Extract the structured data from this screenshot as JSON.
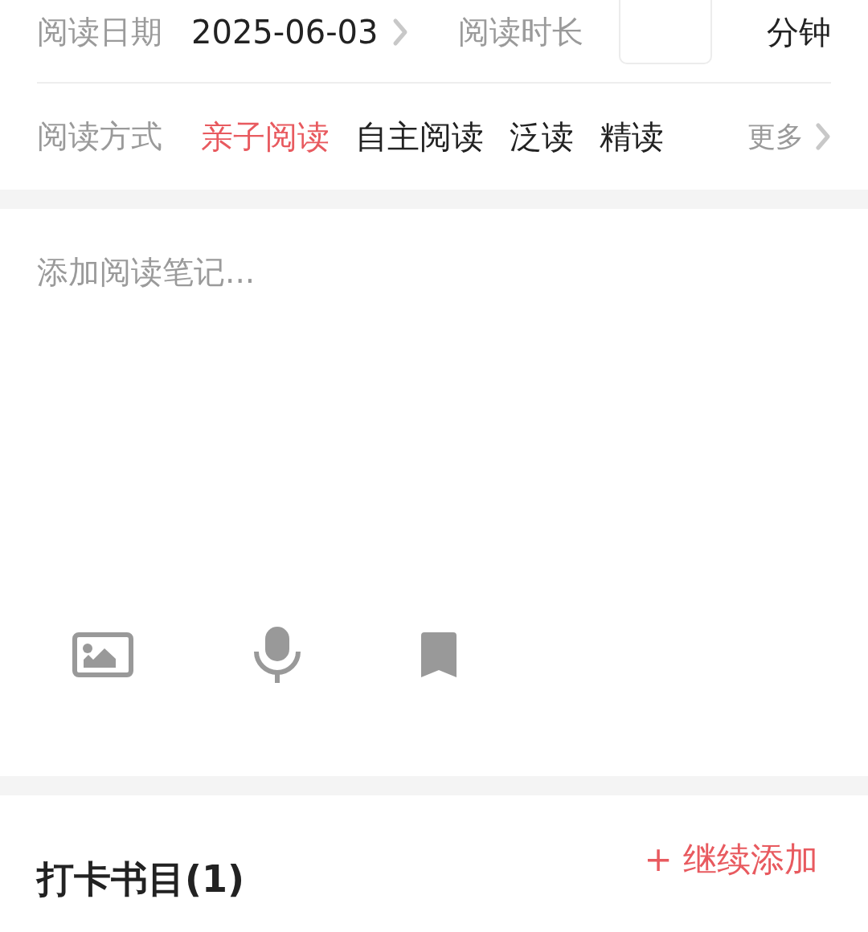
{
  "date_row": {
    "label": "阅读日期",
    "value": "2025-06-03",
    "duration_label": "阅读时长",
    "duration_unit": "分钟"
  },
  "mode_row": {
    "label": "阅读方式",
    "options": [
      {
        "label": "亲子阅读",
        "selected": true
      },
      {
        "label": "自主阅读",
        "selected": false
      },
      {
        "label": "泛读",
        "selected": false
      },
      {
        "label": "精读",
        "selected": false
      }
    ],
    "more": "更多"
  },
  "note": {
    "placeholder": "添加阅读笔记..."
  },
  "books": {
    "title": "打卡书目(1)",
    "add": "+ 继续添加"
  }
}
